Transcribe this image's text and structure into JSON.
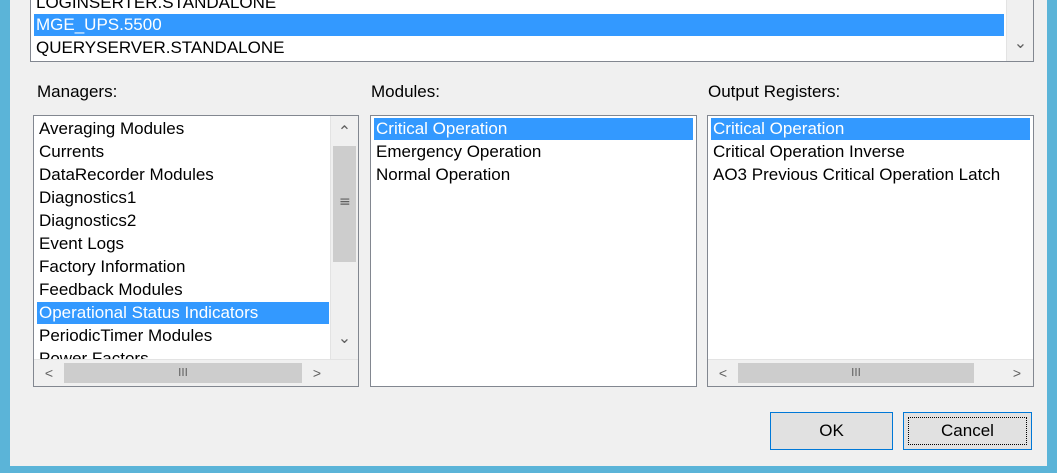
{
  "top_list": {
    "items": [
      "LOGINSERTER.STANDALONE",
      "MGE_UPS.5500",
      "QUERYSERVER.STANDALONE"
    ],
    "selected_index": 1
  },
  "managers": {
    "label": "Managers:",
    "items": [
      "Averaging Modules",
      "Currents",
      "DataRecorder Modules",
      "Diagnostics1",
      "Diagnostics2",
      "Event Logs",
      "Factory Information",
      "Feedback Modules",
      "Operational Status Indicators",
      "PeriodicTimer Modules",
      "Power Factors"
    ],
    "selected_index": 8
  },
  "modules": {
    "label": "Modules:",
    "items": [
      "Critical Operation",
      "Emergency Operation",
      "Normal Operation"
    ],
    "selected_index": 0
  },
  "output_registers": {
    "label": "Output Registers:",
    "items": [
      "Critical Operation",
      "Critical Operation Inverse",
      "AO3 Previous Critical Operation Latch"
    ],
    "selected_index": 0
  },
  "buttons": {
    "ok": "OK",
    "cancel": "Cancel"
  },
  "glyphs": {
    "up": "⌃",
    "down": "⌄",
    "left": "<",
    "right": ">",
    "vgrip": "≡",
    "hgrip": "III"
  },
  "colors": {
    "selection": "#3399ff",
    "frame": "#5bb4d8"
  }
}
